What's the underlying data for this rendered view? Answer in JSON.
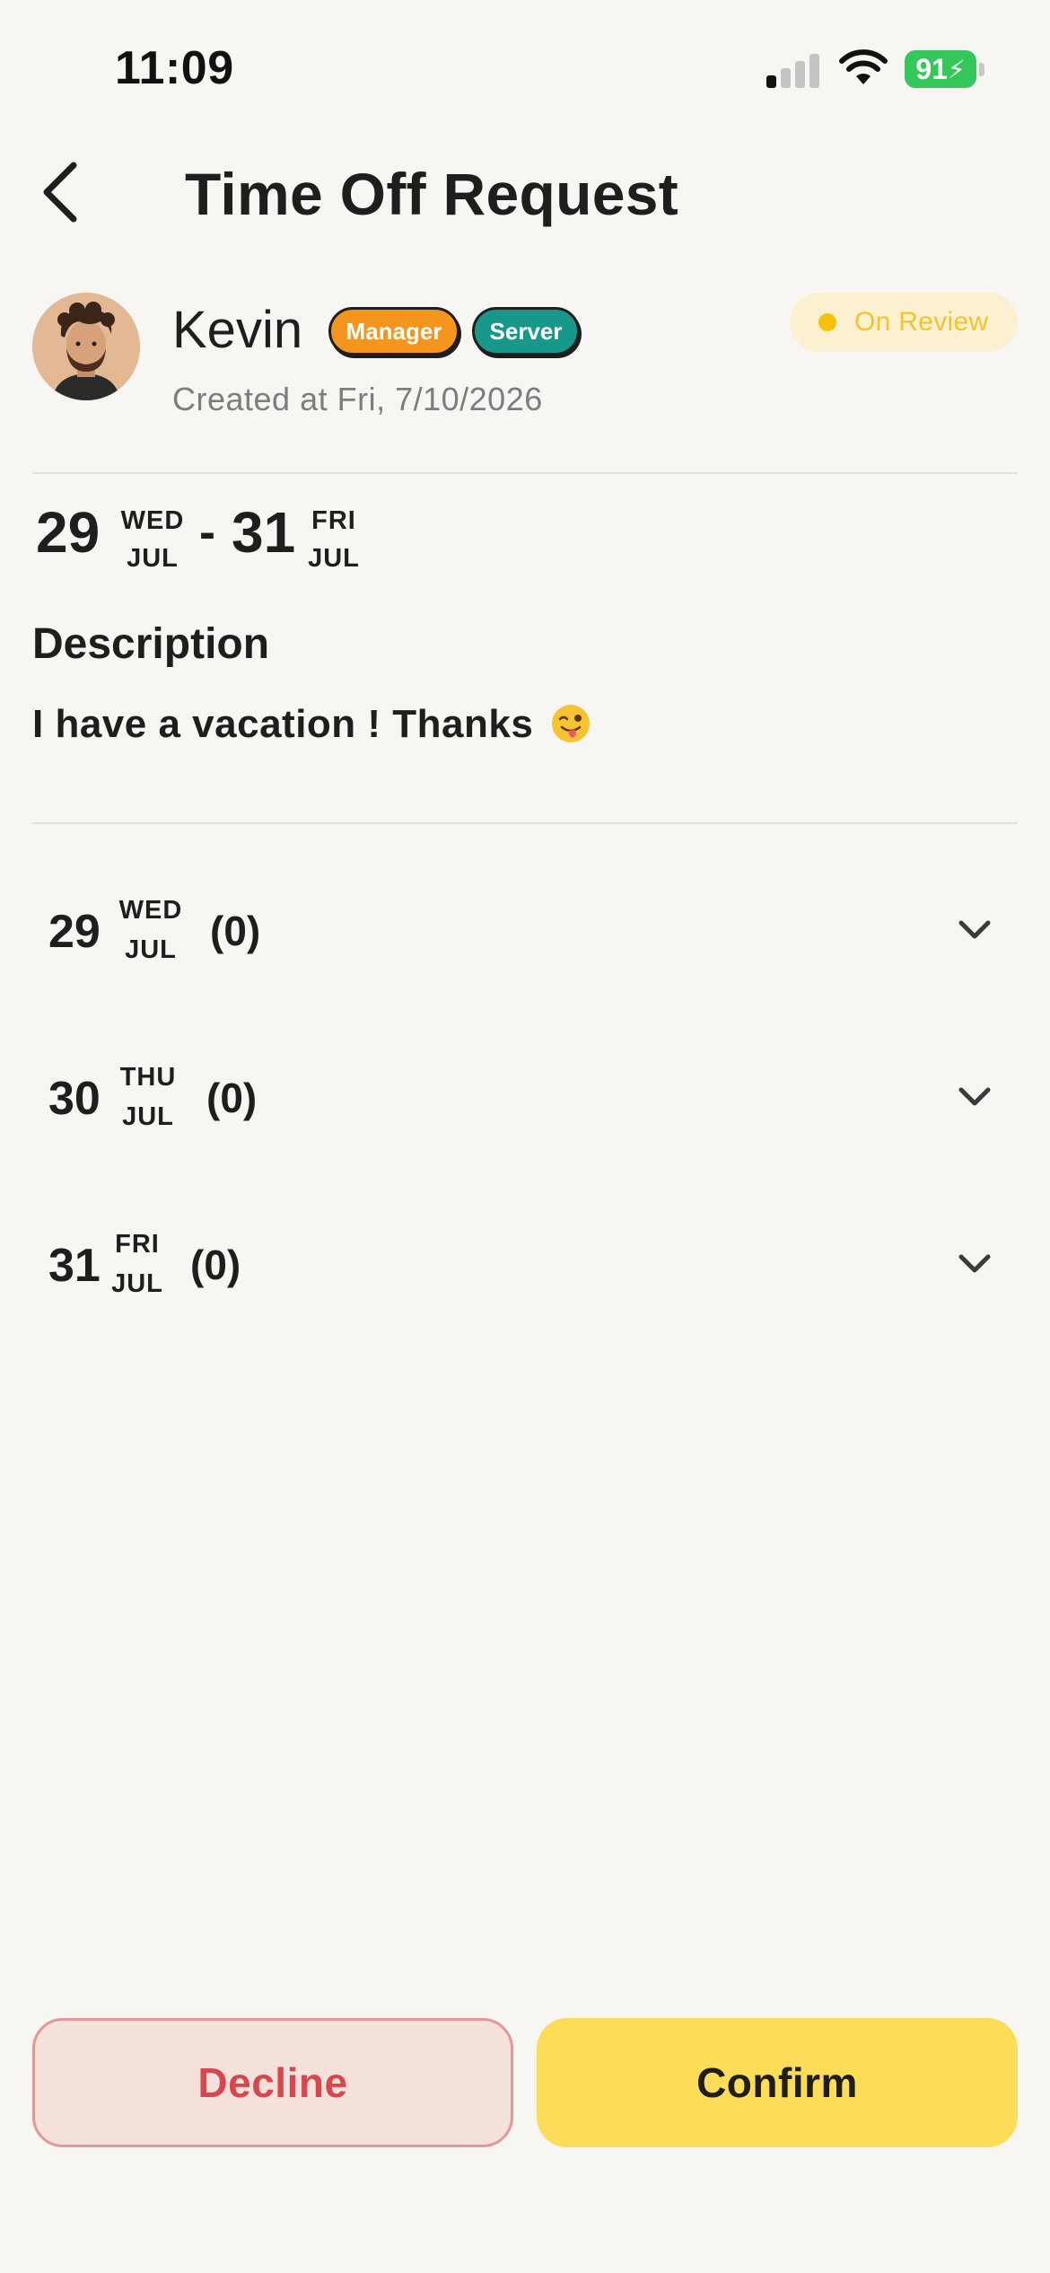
{
  "status_bar": {
    "time": "11:09",
    "battery": "91"
  },
  "header": {
    "title": "Time Off Request"
  },
  "profile": {
    "name": "Kevin",
    "roles": [
      "Manager",
      "Server"
    ],
    "created_at": "Created at Fri, 7/10/2026",
    "status": "On Review"
  },
  "range": {
    "start": {
      "day": "29",
      "weekday": "WED",
      "month": "JUL"
    },
    "separator": "-",
    "end": {
      "day": "31",
      "weekday": "FRI",
      "month": "JUL"
    }
  },
  "description": {
    "title": "Description",
    "text": "I have a vacation ! Thanks"
  },
  "days": [
    {
      "day": "29",
      "weekday": "WED",
      "month": "JUL",
      "count": "(0)"
    },
    {
      "day": "30",
      "weekday": "THU",
      "month": "JUL",
      "count": "(0)"
    },
    {
      "day": "31",
      "weekday": "FRI",
      "month": "JUL",
      "count": "(0)"
    }
  ],
  "actions": {
    "decline": "Decline",
    "confirm": "Confirm"
  },
  "colors": {
    "background": "#f8f6f3",
    "manager_badge": "#f4951d",
    "server_badge": "#18988b",
    "status_text": "#f3c52b",
    "status_pill": "#fbf0cf",
    "decline_bg": "#f4e1dc",
    "decline_text": "#d9474c",
    "confirm_bg": "#fddc58"
  },
  "icons": {
    "back": "chevron-left-icon",
    "expand": "chevron-down-icon",
    "signal": "cellular-signal-icon",
    "wifi": "wifi-icon",
    "battery": "battery-charging-icon",
    "emoji": "winking-face-with-tongue-emoji"
  }
}
